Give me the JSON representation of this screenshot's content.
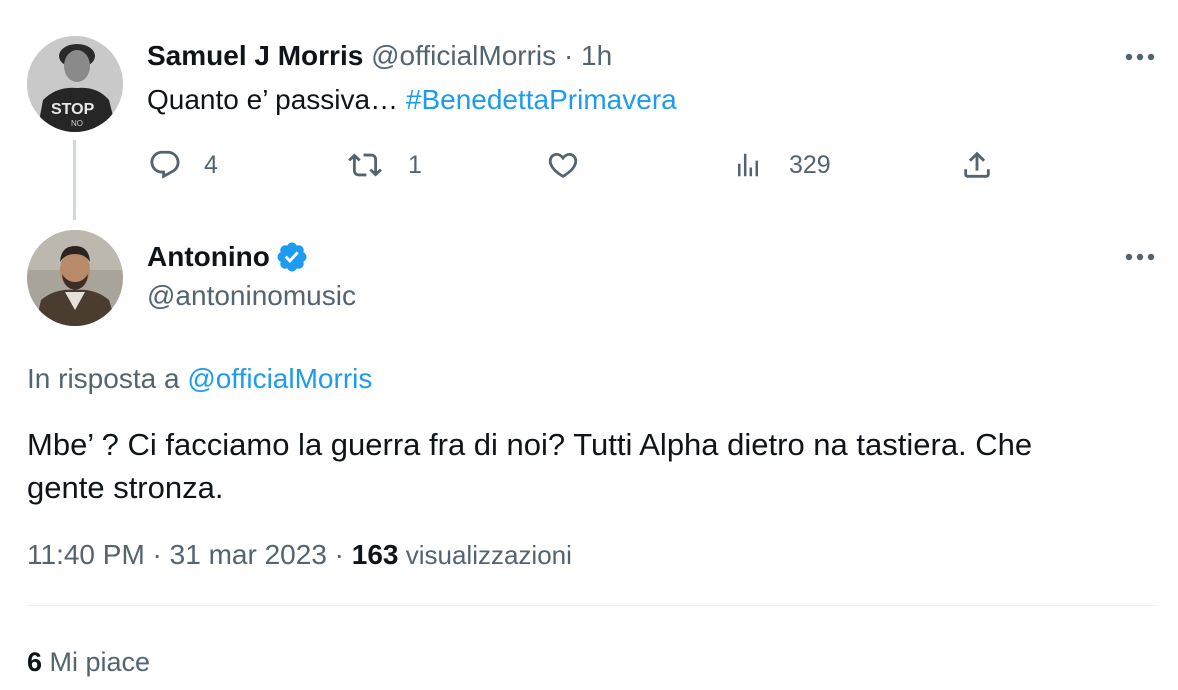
{
  "parent_tweet": {
    "display_name": "Samuel J Morris",
    "handle": "@officialMorris",
    "separator": "·",
    "time": "1h",
    "text_prefix": "Quanto e’ passiva… ",
    "hashtag": "#BenedettaPrimavera",
    "avatar_icon": "avatar-stop-shirt",
    "actions": {
      "reply_count": "4",
      "retweet_count": "1",
      "like_count": "",
      "views_count": "329"
    }
  },
  "main_tweet": {
    "display_name": "Antonino",
    "verified_icon": "verified-badge-icon",
    "handle": "@antoninomusic",
    "reply_prefix": "In risposta a ",
    "reply_to": "@officialMorris",
    "text_line1": "Mbe’ ? Ci facciamo la guerra fra di noi? Tutti Alpha dietro na tastiera. Che",
    "text_line2": "gente stronza.",
    "time": "11:40 PM",
    "dot1": " · ",
    "date": "31 mar 2023",
    "dot2": " · ",
    "views_count": "163",
    "views_label": " visualizzazioni",
    "likes_count": "6",
    "likes_label": " Mi piace"
  },
  "colors": {
    "accent": "#1d9bf0",
    "muted": "#536471",
    "text": "#0f1419",
    "divider": "#eff3f4"
  }
}
